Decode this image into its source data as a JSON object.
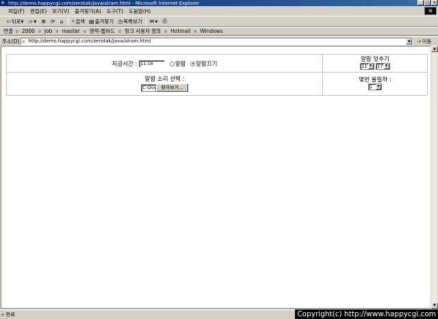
{
  "window": {
    "title": "http://demo.happycgi.com/zerotak/java/alram.html - Microsoft Internet Explorer",
    "buttons": {
      "minimize": "_",
      "maximize": "□",
      "close": "x"
    }
  },
  "menubar": {
    "items": [
      "파일(F)",
      "편집(E)",
      "보기(V)",
      "즐겨찾기(A)",
      "도구(T)",
      "도움말(H)"
    ]
  },
  "toolbar": {
    "back": "뒤로",
    "search": "검색",
    "favorites": "즐겨찾기",
    "history": "목록보기"
  },
  "links": {
    "label": "연결",
    "items": [
      "2000",
      "job",
      "master",
      "영락-웹하드",
      "링크 사용자 정의",
      "Hotmail",
      "Windows"
    ]
  },
  "address": {
    "label": "주소(D)",
    "url": "http://demo.happycgi.com/zerotak/java/alram.html",
    "go": "이동"
  },
  "page": {
    "time_label": "지금시간 :",
    "time_value": "11:16",
    "radio_alarm": "알람",
    "radio_alarm_off": "알람끄기",
    "radio_selected": "알람끄기",
    "set_alarm_label": "알람 맞추기",
    "hour_value": "11",
    "minute_value": "17",
    "sound_label": "알람 소리 선택 :",
    "file_value": "C:\\Doc",
    "browse_label": "찾아보기...",
    "repeat_label": "몇번 울릴까 :",
    "repeat_value": "1"
  },
  "status": {
    "text": "완료"
  },
  "overlay": {
    "copyright": "Copyright(c) http://www.happycgi.com"
  }
}
